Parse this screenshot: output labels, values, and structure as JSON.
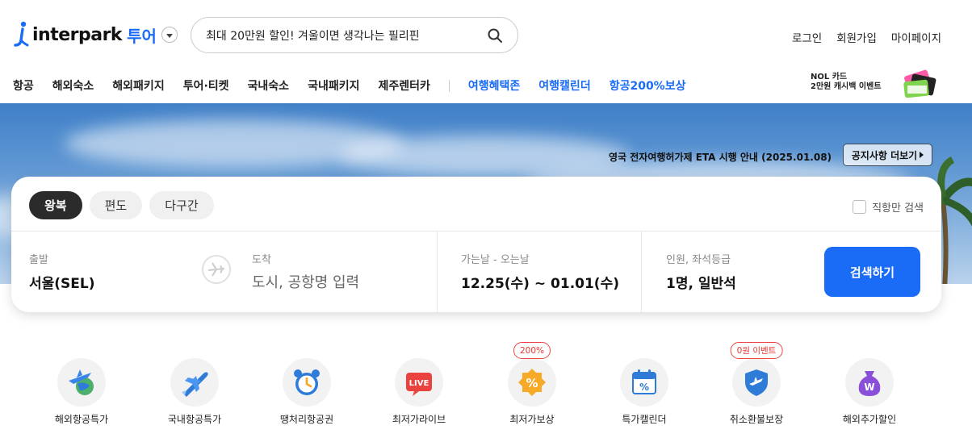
{
  "header": {
    "logo_text": "interpark",
    "logo_sub": "투어",
    "search_value": "최대 20만원 할인! 겨울이면 생각나는 필리핀",
    "links": [
      "로그인",
      "회원가입",
      "마이페이지"
    ]
  },
  "nav": {
    "items": [
      "항공",
      "해외숙소",
      "해외패키지",
      "투어·티켓",
      "국내숙소",
      "국내패키지",
      "제주렌터카"
    ],
    "highlight_items": [
      "여행혜택존",
      "여행캘린더",
      "항공200%보상"
    ],
    "promo_line1": "NOL 카드",
    "promo_line2": "2만원 캐시백 이벤트"
  },
  "banner": {
    "notice": "영국 전자여행허가제 ETA 시행 안내 (2025.01.08)",
    "notice_button": "공지사항 더보기"
  },
  "panel": {
    "trip_tabs": [
      "왕복",
      "편도",
      "다구간"
    ],
    "active_tab": "왕복",
    "direct_only": "직항만 검색",
    "depart_label": "출발",
    "depart_value": "서울(SEL)",
    "arrive_label": "도착",
    "arrive_placeholder": "도시, 공항명 입력",
    "date_label": "가는날 - 오는날",
    "date_value": "12.25(수) ~ 01.01(수)",
    "pax_label": "인원, 좌석등급",
    "pax_value": "1명, 일반석",
    "search_button": "검색하기"
  },
  "quick_menu": [
    {
      "label": "해외항공특가",
      "icon": "globe-plane-icon"
    },
    {
      "label": "국내항공특가",
      "icon": "plane-icon"
    },
    {
      "label": "땡처리항공권",
      "icon": "alarm-clock-icon"
    },
    {
      "label": "최저가라이브",
      "icon": "live-tv-icon"
    },
    {
      "label": "최저가보상",
      "icon": "percent-badge-icon",
      "badge": "200%"
    },
    {
      "label": "특가캘린더",
      "icon": "calendar-percent-icon"
    },
    {
      "label": "취소환불보장",
      "icon": "shield-plane-icon",
      "badge": "0원 이벤트"
    },
    {
      "label": "해외추가할인",
      "icon": "money-bag-icon"
    }
  ],
  "colors": {
    "brand_blue": "#1a6bf5",
    "badge_red": "#e33333"
  }
}
